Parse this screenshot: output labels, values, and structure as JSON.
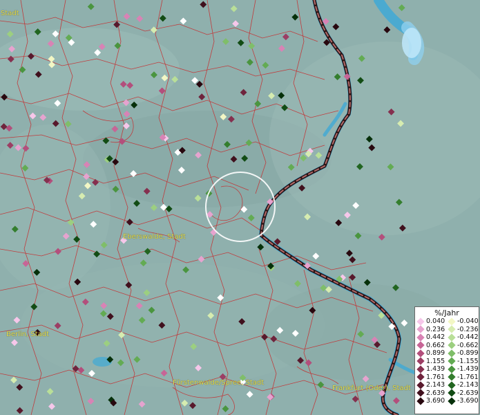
{
  "map": {
    "cities": [
      {
        "name": "Stadt"
      },
      {
        "name": "Eberswalde, Stadt"
      },
      {
        "name": "Berlin, Stadt"
      },
      {
        "name": "Fürstenwalde/Spree, Stadt"
      },
      {
        "name": "Frankfurt (Oder), Stadt"
      }
    ]
  },
  "legend": {
    "title": "%/Jahr",
    "positive": [
      {
        "label": "0.040",
        "color": "#f6c7ea"
      },
      {
        "label": "0.236",
        "color": "#e6a3cf"
      },
      {
        "label": "0.442",
        "color": "#d883b5"
      },
      {
        "label": "0.662",
        "color": "#c76596"
      },
      {
        "label": "0.899",
        "color": "#b34f7c"
      },
      {
        "label": "1.155",
        "color": "#9c3e64"
      },
      {
        "label": "1.439",
        "color": "#85304f"
      },
      {
        "label": "1.761",
        "color": "#6f243d"
      },
      {
        "label": "2.143",
        "color": "#58192c"
      },
      {
        "label": "2.639",
        "color": "#40101d"
      },
      {
        "label": "3.690",
        "color": "#28080f"
      }
    ],
    "negative": [
      {
        "label": "-0.040",
        "color": "#f3f7c5"
      },
      {
        "label": "-0.236",
        "color": "#d6ecb0"
      },
      {
        "label": "-0.442",
        "color": "#b9df98"
      },
      {
        "label": "-0.662",
        "color": "#9ccf80"
      },
      {
        "label": "-0.899",
        "color": "#7fbe69"
      },
      {
        "label": "-1.155",
        "color": "#63ab53"
      },
      {
        "label": "-1.439",
        "color": "#4a953f"
      },
      {
        "label": "-1.761",
        "color": "#347e2e"
      },
      {
        "label": "-2.143",
        "color": "#216520"
      },
      {
        "label": "-2.639",
        "color": "#124c14"
      },
      {
        "label": "-3.690",
        "color": "#06300a"
      }
    ]
  },
  "colors": {
    "background": "#8fb0ad",
    "boundary": "#c8282a",
    "water": "#3fa9d6",
    "border": "#2a1414",
    "city_label": "#e8e34a",
    "highlight": "#ffffff"
  }
}
